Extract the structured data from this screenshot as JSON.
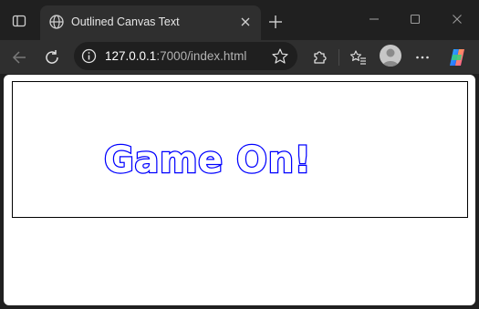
{
  "tab": {
    "title": "Outlined Canvas Text"
  },
  "address_bar": {
    "host": "127.0.0.1",
    "rest": ":7000/index.html"
  },
  "canvas": {
    "text": "Game On!",
    "stroke_color": "#0000ff",
    "fill_color": "#ffffff",
    "border_color": "#000000"
  },
  "icons": {
    "sidebar": "sidebar-toggle-icon",
    "tab_favicon": "globe-icon",
    "tab_close": "close-icon",
    "new_tab": "plus-icon",
    "minimize": "minimize-icon",
    "maximize": "maximize-icon",
    "close_window": "close-icon",
    "back": "back-arrow-icon",
    "refresh": "refresh-icon",
    "site_info": "info-icon",
    "favorite": "star-icon",
    "extensions": "puzzle-icon",
    "favorites_list": "favorites-list-icon",
    "profile": "avatar",
    "more": "more-icon",
    "copilot": "copilot-icon"
  },
  "colors": {
    "frame": "#202020",
    "toolbar": "#2f2f2f",
    "omnibox": "#1f1f1f",
    "page": "#ffffff"
  }
}
